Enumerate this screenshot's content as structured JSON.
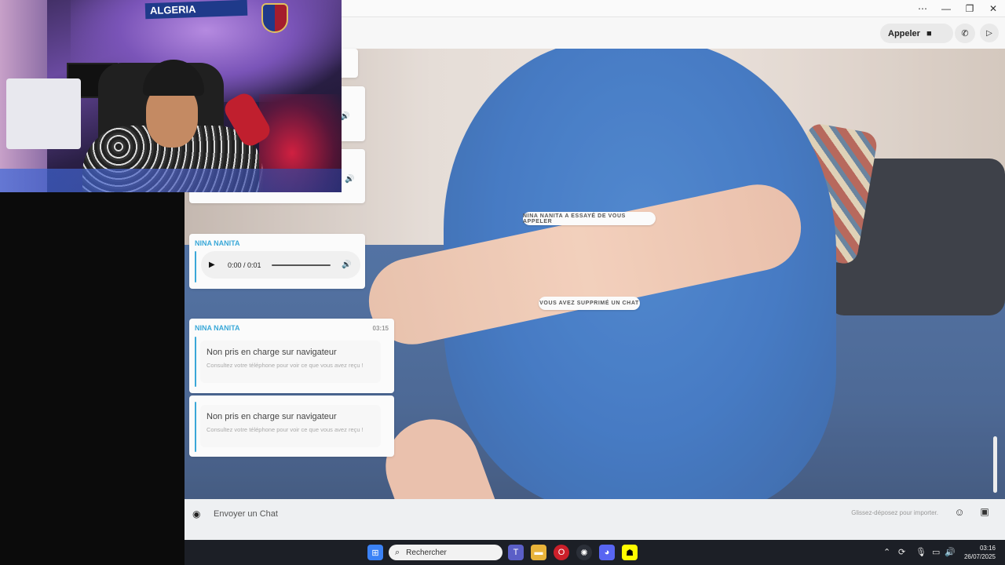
{
  "webcam": {
    "flag_text": "ALGERIA"
  },
  "window": {
    "more": "⋯",
    "minimize": "—",
    "maximize": "❐",
    "close": "✕"
  },
  "header": {
    "call_label": "Appeler"
  },
  "notices": {
    "missed_call": "NINA NANITA A ESSAYÉ DE VOUS APPELER",
    "deleted_chat": "VOUS AVEZ SUPPRIMÉ UN CHAT"
  },
  "messages": [
    {
      "sender": "NINA NANITA",
      "type": "audio",
      "time_display": "0:00 / 0:01"
    },
    {
      "sender": "NINA NANITA",
      "time": "03:15",
      "type": "unsupported",
      "title": "Non pris en charge sur navigateur",
      "subtitle": "Consultez votre téléphone pour voir ce que vous avez reçu !"
    },
    {
      "type": "unsupported",
      "title": "Non pris en charge sur navigateur",
      "subtitle": "Consultez votre téléphone pour voir ce que vous avez reçu !"
    }
  ],
  "composer": {
    "placeholder": "Envoyer un Chat",
    "drop_hint": "Glissez-déposez pour importer."
  },
  "taskbar": {
    "search_placeholder": "Rechercher",
    "time": "03:16",
    "date": "26/07/2025"
  },
  "colors": {
    "accent": "#3aa8d8",
    "taskbar": "#1c1f26"
  }
}
